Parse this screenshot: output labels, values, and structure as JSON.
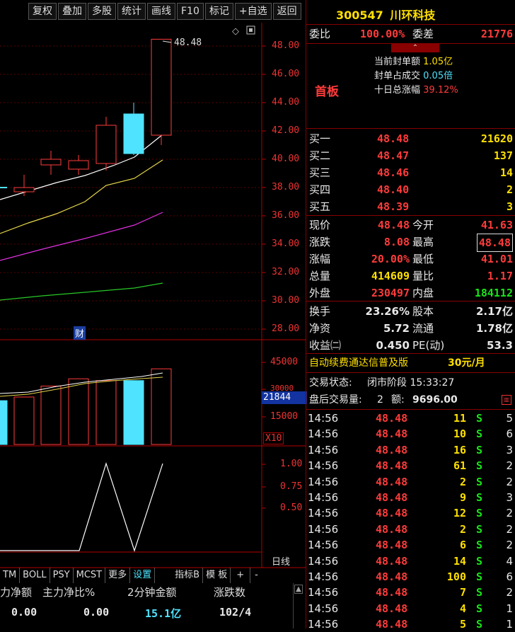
{
  "toolbar": {
    "buttons": [
      "复权",
      "叠加",
      "多股",
      "统计",
      "画线",
      "F10",
      "标记",
      "+自选",
      "返回"
    ]
  },
  "stock": {
    "code": "300547",
    "name": "川环科技"
  },
  "order_ratio": {
    "label_ratio": "委比",
    "ratio": "100.00%",
    "label_diff": "委差",
    "diff": "21776"
  },
  "seal": {
    "tag": "首板",
    "line1_label": "当前封单额",
    "line1_value": "1.05亿",
    "line2_label": "封单占成交",
    "line2_value": "0.05倍",
    "line3_label": "十日总涨幅",
    "line3_value": "39.12%"
  },
  "bids": [
    {
      "label": "买一",
      "price": "48.48",
      "vol": "21620"
    },
    {
      "label": "买二",
      "price": "48.47",
      "vol": "137"
    },
    {
      "label": "买三",
      "price": "48.46",
      "vol": "14"
    },
    {
      "label": "买四",
      "price": "48.40",
      "vol": "2"
    },
    {
      "label": "买五",
      "price": "48.39",
      "vol": "3"
    }
  ],
  "quote": [
    {
      "l1": "现价",
      "v1": "48.48",
      "l2": "今开",
      "v2": "41.63"
    },
    {
      "l1": "涨跌",
      "v1": "8.08",
      "l2": "最高",
      "v2": "48.48"
    },
    {
      "l1": "涨幅",
      "v1": "20.00%",
      "l2": "最低",
      "v2": "41.01"
    },
    {
      "l1": "总量",
      "v1": "414609",
      "l2": "量比",
      "v2": "1.17"
    },
    {
      "l1": "外盘",
      "v1": "230497",
      "l2": "内盘",
      "v2": "184112"
    }
  ],
  "fund": [
    {
      "l1": "换手",
      "v1": "23.26%",
      "l2": "股本",
      "v2": "2.17亿"
    },
    {
      "l1": "净资",
      "v1": "5.72",
      "l2": "流通",
      "v2": "1.78亿"
    },
    {
      "l1": "收益㈡",
      "v1": "0.450",
      "l2": "PE(动)",
      "v2": "53.3"
    }
  ],
  "ad": {
    "text": "自动续费通达信普及版",
    "price": "30元/月"
  },
  "status": {
    "trade_label": "交易状态:",
    "trade_value": "闭市阶段 15:33:27",
    "after_label": "盘后交易量:",
    "after_vol": "2",
    "after_amt_label": "额:",
    "after_amt": "9696.00"
  },
  "ticks": [
    {
      "t": "14:56",
      "p": "48.48",
      "v": "11",
      "s": "S",
      "n": "5"
    },
    {
      "t": "14:56",
      "p": "48.48",
      "v": "10",
      "s": "S",
      "n": "6"
    },
    {
      "t": "14:56",
      "p": "48.48",
      "v": "16",
      "s": "S",
      "n": "3"
    },
    {
      "t": "14:56",
      "p": "48.48",
      "v": "61",
      "s": "S",
      "n": "2"
    },
    {
      "t": "14:56",
      "p": "48.48",
      "v": "2",
      "s": "S",
      "n": "2"
    },
    {
      "t": "14:56",
      "p": "48.48",
      "v": "9",
      "s": "S",
      "n": "3"
    },
    {
      "t": "14:56",
      "p": "48.48",
      "v": "12",
      "s": "S",
      "n": "2"
    },
    {
      "t": "14:56",
      "p": "48.48",
      "v": "2",
      "s": "S",
      "n": "2"
    },
    {
      "t": "14:56",
      "p": "48.48",
      "v": "6",
      "s": "S",
      "n": "2"
    },
    {
      "t": "14:56",
      "p": "48.48",
      "v": "14",
      "s": "S",
      "n": "4"
    },
    {
      "t": "14:56",
      "p": "48.48",
      "v": "100",
      "s": "S",
      "n": "6"
    },
    {
      "t": "14:56",
      "p": "48.48",
      "v": "7",
      "s": "S",
      "n": "2"
    },
    {
      "t": "14:56",
      "p": "48.48",
      "v": "4",
      "s": "S",
      "n": "1"
    },
    {
      "t": "14:56",
      "p": "48.48",
      "v": "5",
      "s": "S",
      "n": "1"
    }
  ],
  "chart": {
    "price_ticks": [
      "48.00",
      "46.00",
      "44.00",
      "42.00",
      "40.00",
      "38.00",
      "36.00",
      "34.00",
      "32.00",
      "30.00",
      "28.00"
    ],
    "high_label": "48.48",
    "event_tag": "财",
    "vol_ticks": [
      "45000",
      "30000",
      "15000"
    ],
    "vol_current": "21844",
    "vol_mult": "X10",
    "ind_ticks": [
      "1.00",
      "0.75",
      "0.50"
    ],
    "period": "日线"
  },
  "candles": [
    {
      "o": 37.7,
      "c": 38.0,
      "h": 38.9,
      "l": 37.4,
      "up": true
    },
    {
      "o": 39.6,
      "c": 40.0,
      "h": 40.6,
      "l": 38.9,
      "up": true
    },
    {
      "o": 39.3,
      "c": 39.9,
      "h": 40.3,
      "l": 38.9,
      "up": true
    },
    {
      "o": 39.7,
      "c": 42.4,
      "h": 43.0,
      "l": 39.2,
      "up": true
    },
    {
      "o": 43.2,
      "c": 40.4,
      "h": 44.0,
      "l": 40.3,
      "up": false
    },
    {
      "o": 41.7,
      "c": 48.48,
      "h": 48.48,
      "l": 41.0,
      "up": true
    }
  ],
  "volumes": [
    24000,
    26000,
    32000,
    36000,
    35000,
    35000,
    41461
  ],
  "indicator_tabs": [
    "TM",
    "BOLL",
    "PSY",
    "MCST",
    "更多",
    "设置",
    "指标B",
    "模 板",
    "+",
    "-"
  ],
  "flow": {
    "headers": [
      "力净额",
      "主力净比%",
      "2分钟金额",
      "涨跌数"
    ],
    "row": [
      "0.00",
      "0.00",
      "15.1亿",
      "102/4"
    ]
  }
}
